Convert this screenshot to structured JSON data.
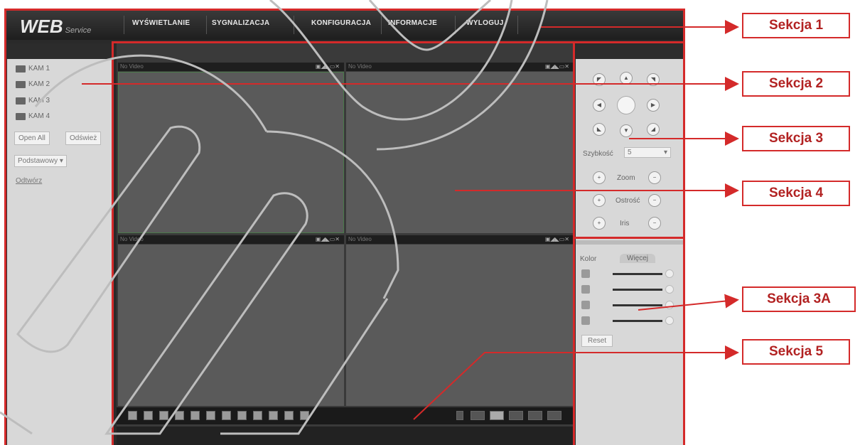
{
  "app": {
    "logo": "WEB",
    "logo_sub": "Service"
  },
  "nav": {
    "tabs": [
      "WYŚWIETLANIE",
      "SYGNALIZACJA",
      "KONFIGURACJA",
      "INFORMACJE",
      "WYLOGUJ"
    ]
  },
  "left_panel": {
    "cameras": [
      "KAM 1",
      "KAM 2",
      "KAM 3",
      "KAM 4"
    ],
    "open_all_label": "Open All",
    "refresh_label": "Odśwież",
    "stream_select": "Podstawowy",
    "link_label": "Odtwórz"
  },
  "video": {
    "pane_titles": [
      "No Video",
      "No Video",
      "No Video",
      "No Video"
    ]
  },
  "ptz": {
    "speed_label": "Szybkość",
    "speed_value": "5",
    "zoom_label": "Zoom",
    "focus_label": "Ostrość",
    "iris_label": "Iris"
  },
  "color_panel": {
    "tab_color": "Kolor",
    "tab_other": "Więcej",
    "reset_label": "Reset"
  },
  "callouts": [
    "Sekcja 1",
    "Sekcja 2",
    "Sekcja 3",
    "Sekcja 4",
    "Sekcja 3A",
    "Sekcja 5"
  ],
  "colors": {
    "accent_red": "#d42a2a",
    "callout_text": "#b22222",
    "dark_bar": "#1e1e1e",
    "panel_grey": "#d8d8d8",
    "video_grey": "#5a5a5a"
  }
}
